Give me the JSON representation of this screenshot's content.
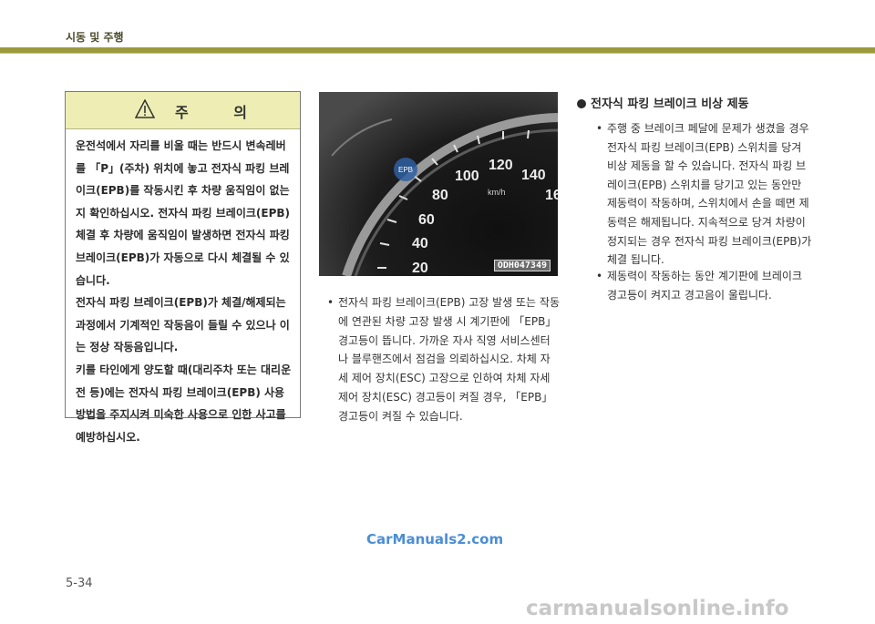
{
  "header": {
    "title": "시동 및 주행"
  },
  "caution": {
    "title": "주 의",
    "paragraphs": [
      "운전석에서 자리를 비울 때는 반드시 변속레버를 「P」(주차) 위치에 놓고 전자식 파킹 브레이크(EPB)를 작동시킨 후 차량 움직임이 없는지 확인하십시오. 전자식 파킹 브레이크(EPB) 체결 후 차량에 움직임이 발생하면 전자식 파킹 브레이크(EPB)가 자동으로 다시 체결될 수 있습니다.",
      "전자식 파킹 브레이크(EPB)가 체결/해제되는 과정에서 기계적인 작동음이 들릴 수 있으나 이는 정상 작동음입니다.",
      "키를 타인에게 양도할 때(대리주차 또는 대리운전 등)에는 전자식 파킹 브레이크(EPB) 사용 방법을 주지시켜 미숙한 사용으로 인한 사고를 예방하십시오."
    ]
  },
  "figure": {
    "code": "ODH047349",
    "epb_label": "EPB",
    "unit": "km/h",
    "ticks": [
      "20",
      "40",
      "60",
      "80",
      "100",
      "120",
      "140",
      "16"
    ]
  },
  "middle_note": "전자식 파킹 브레이크(EPB) 고장 발생 또는 작동에 연관된 차량 고장 발생 시 계기판에 「EPB」경고등이 뜹니다. 가까운 자사 직영 서비스센터나 블루핸즈에서 점검을 의뢰하십시오. 차체 자세 제어 장치(ESC) 고장으로 인하여 차체 자세 제어 장치(ESC) 경고등이 켜질 경우, 「EPB」 경고등이 켜질 수 있습니다.",
  "section": {
    "heading": "전자식 파킹 브레이크 비상 제동",
    "items": [
      "주행 중 브레이크 페달에 문제가 생겼을 경우 전자식 파킹 브레이크(EPB) 스위치를 당겨 비상 제동을 할 수 있습니다. 전자식 파킹 브레이크(EPB) 스위치를 당기고 있는 동안만 제동력이 작동하며, 스위치에서 손을 떼면 제동력은 해제됩니다. 지속적으로 당겨 차량이 정지되는 경우 전자식 파킹 브레이크(EPB)가 체결 됩니다.",
      "제동력이 작동하는 동안 계기판에 브레이크 경고등이 켜지고 경고음이 울립니다."
    ]
  },
  "bullet_char": "•",
  "watermark": "CarManuals2.com",
  "page_number": "5-34",
  "footer_watermark": "carmanualsonline.info",
  "colors": {
    "header_bar": "#9a9a3c",
    "caution_head": "#eeeeb4",
    "watermark": "#4a8ed6"
  }
}
